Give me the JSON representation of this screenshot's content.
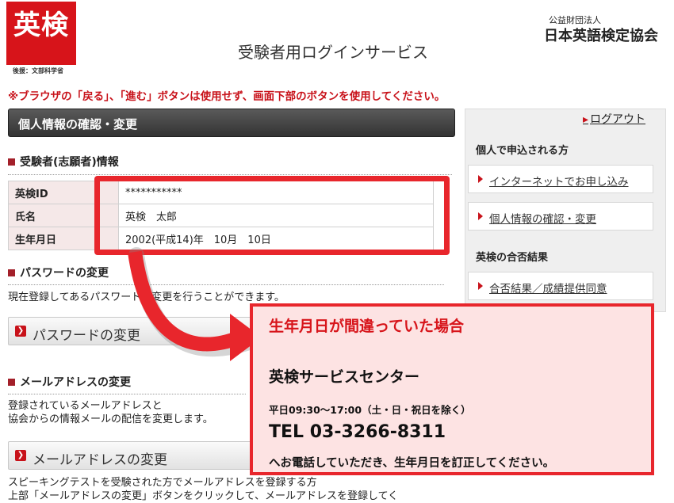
{
  "header": {
    "logo_text": "英検",
    "logo_sub": "後援：文部科学省",
    "service_title": "受験者用ログインサービス",
    "org_small": "公益財団法人",
    "org_name": "日本英語検定協会"
  },
  "warning": "※ブラウザの「戻る」、「進む」ボタンは使用せず、画面下部のボタンを使用してください。",
  "main": {
    "panel_title": "個人情報の確認・変更",
    "applicant_heading": "受験者(志願者)情報",
    "applicant_rows": [
      {
        "label": "英検ID",
        "value": "***********"
      },
      {
        "label": "氏名",
        "value": "英検　太郎"
      },
      {
        "label": "生年月日",
        "value": "2002(平成14)年　10月　10日"
      }
    ],
    "password_heading": "パスワードの変更",
    "password_desc": "現在登録してあるパスワードの変更を行うことができます。",
    "password_button": "パスワードの変更",
    "mail_heading": "メールアドレスの変更",
    "mail_desc_1": "登録されているメールアドレスと",
    "mail_desc_2": "協会からの情報メールの配信を変更します。",
    "mail_button": "メールアドレスの変更",
    "footer_1": "スピーキングテストを受験された方でメールアドレスを登録する方",
    "footer_2": "上部「メールアドレスの変更」ボタンをクリックして、メールアドレスを登録してく"
  },
  "sidebar": {
    "logout": "ログアウト",
    "group_individual": "個人で申込される方",
    "link_internet": "インターネットでお申し込み",
    "link_personal": "個人情報の確認・変更",
    "group_results": "英検の合否結果",
    "link_results": "合否結果／成績提供同意"
  },
  "callout": {
    "title": "生年月日が間違っていた場合",
    "center": "英検サービスセンター",
    "hours": "平日09:30～17:00（土・日・祝日を除く）",
    "tel": "TEL 03-3266-8311",
    "note": "へお電話していただき、生年月日を訂正してください。"
  },
  "colors": {
    "accent_red": "#e8262c",
    "brand_red": "#d7141a"
  }
}
